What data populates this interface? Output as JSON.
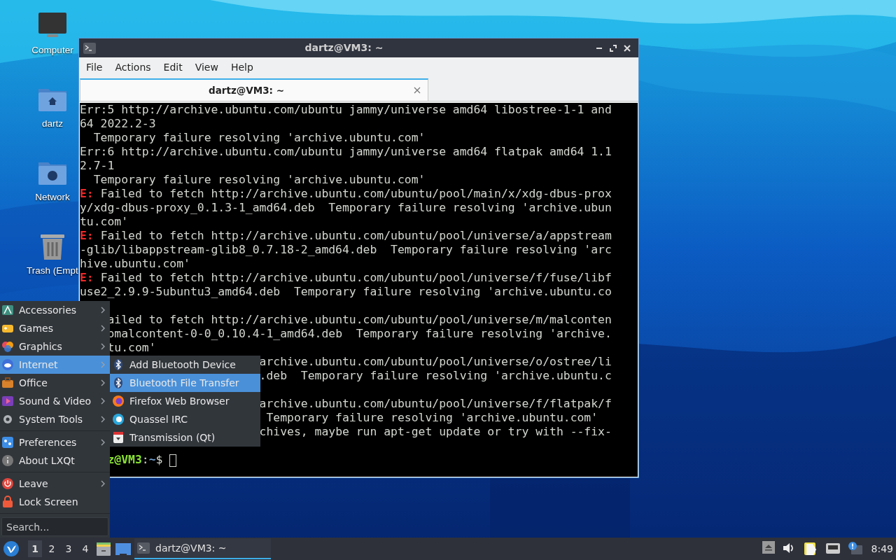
{
  "desktop_icons": [
    {
      "kind": "computer",
      "label": "Computer"
    },
    {
      "kind": "home",
      "label": "dartz"
    },
    {
      "kind": "network",
      "label": "Network"
    },
    {
      "kind": "trash",
      "label": "Trash (Empt"
    }
  ],
  "window": {
    "title": "dartz@VM3: ~",
    "menu": [
      "File",
      "Actions",
      "Edit",
      "View",
      "Help"
    ],
    "tabs": [
      {
        "label": "dartz@VM3: ~",
        "selected": true
      }
    ],
    "terminal_lines": [
      {
        "kind": "plain",
        "text": "Err:5 http://archive.ubuntu.com/ubuntu jammy/universe amd64 libostree-1-1 and"
      },
      {
        "kind": "plain",
        "text": "64 2022.2-3"
      },
      {
        "kind": "plain",
        "text": "  Temporary failure resolving 'archive.ubuntu.com'"
      },
      {
        "kind": "plain",
        "text": "Err:6 http://archive.ubuntu.com/ubuntu jammy/universe amd64 flatpak amd64 1.1"
      },
      {
        "kind": "plain",
        "text": "2.7-1"
      },
      {
        "kind": "plain",
        "text": "  Temporary failure resolving 'archive.ubuntu.com'"
      },
      {
        "kind": "error",
        "label": "E:",
        "text": "Failed to fetch http://archive.ubuntu.com/ubuntu/pool/main/x/xdg-dbus-prox"
      },
      {
        "kind": "plain",
        "text": "y/xdg-dbus-proxy_0.1.3-1_amd64.deb  Temporary failure resolving 'archive.ubun"
      },
      {
        "kind": "plain",
        "text": "tu.com'"
      },
      {
        "kind": "error",
        "label": "E:",
        "text": "Failed to fetch http://archive.ubuntu.com/ubuntu/pool/universe/a/appstream"
      },
      {
        "kind": "plain",
        "text": "-glib/libappstream-glib8_0.7.18-2_amd64.deb  Temporary failure resolving 'arc"
      },
      {
        "kind": "plain",
        "text": "hive.ubuntu.com'"
      },
      {
        "kind": "error",
        "label": "E:",
        "text": "Failed to fetch http://archive.ubuntu.com/ubuntu/pool/universe/f/fuse/libf"
      },
      {
        "kind": "plain",
        "text": "use2_2.9.9-5ubuntu3_amd64.deb  Temporary failure resolving 'archive.ubuntu.co"
      },
      {
        "kind": "blank"
      },
      {
        "kind": "plain",
        "text": "    ailed to fetch http://archive.ubuntu.com/ubuntu/pool/universe/m/malconten"
      },
      {
        "kind": "plain",
        "text": "    omalcontent-0-0_0.10.4-1_amd64.deb  Temporary failure resolving 'archive."
      },
      {
        "kind": "plain",
        "text": "    tu.com'"
      },
      {
        "kind": "plain",
        "text": "                          archive.ubuntu.com/ubuntu/pool/universe/o/ostree/li"
      },
      {
        "kind": "plain",
        "text": "                          .deb  Temporary failure resolving 'archive.ubuntu.c"
      },
      {
        "kind": "blank"
      },
      {
        "kind": "plain",
        "text": "                          archive.ubuntu.com/ubuntu/pool/universe/f/flatpak/f"
      },
      {
        "kind": "plain",
        "text": "                           Temporary failure resolving 'archive.ubuntu.com'"
      },
      {
        "kind": "plain",
        "text": "                          chives, maybe run apt-get update or try with --fix-"
      },
      {
        "kind": "blank"
      },
      {
        "kind": "prompt",
        "user_host": "    z@VM3",
        "separator": ":",
        "path": "~",
        "symbol": "$"
      }
    ]
  },
  "start_menu": {
    "items": [
      {
        "kind": "accessories",
        "label": "Accessories",
        "submenu": true,
        "selected": false
      },
      {
        "kind": "games",
        "label": "Games",
        "submenu": true,
        "selected": false
      },
      {
        "kind": "graphics",
        "label": "Graphics",
        "submenu": true,
        "selected": false
      },
      {
        "kind": "internet",
        "label": "Internet",
        "submenu": true,
        "selected": true
      },
      {
        "kind": "office",
        "label": "Office",
        "submenu": true,
        "selected": false
      },
      {
        "kind": "sound",
        "label": "Sound & Video",
        "submenu": true,
        "selected": false
      },
      {
        "kind": "system",
        "label": "System Tools",
        "submenu": true,
        "selected": false
      },
      {
        "kind": "separator"
      },
      {
        "kind": "preferences",
        "label": "Preferences",
        "submenu": true,
        "selected": false
      },
      {
        "kind": "about",
        "label": "About LXQt",
        "submenu": false,
        "selected": false
      },
      {
        "kind": "separator"
      },
      {
        "kind": "leave",
        "label": "Leave",
        "submenu": true,
        "selected": false
      },
      {
        "kind": "lock",
        "label": "Lock Screen",
        "submenu": false,
        "selected": false
      },
      {
        "kind": "separator"
      }
    ],
    "search": {
      "placeholder": "Search..."
    }
  },
  "internet_submenu": [
    {
      "kind": "bluetooth",
      "label": "Add Bluetooth Device",
      "selected": false
    },
    {
      "kind": "bluetooth",
      "label": "Bluetooth File Transfer",
      "selected": true
    },
    {
      "kind": "firefox",
      "label": "Firefox Web Browser",
      "selected": false
    },
    {
      "kind": "quassel",
      "label": "Quassel IRC",
      "selected": false
    },
    {
      "kind": "transmission",
      "label": "Transmission (Qt)",
      "selected": false
    }
  ],
  "taskbar": {
    "desktops": [
      {
        "label": "1",
        "selected": true
      },
      {
        "label": "2",
        "selected": false
      },
      {
        "label": "3",
        "selected": false
      },
      {
        "label": "4",
        "selected": false
      }
    ],
    "tasks": [
      {
        "label": "dartz@VM3: ~",
        "selected": true
      }
    ],
    "clock": "8:49"
  }
}
